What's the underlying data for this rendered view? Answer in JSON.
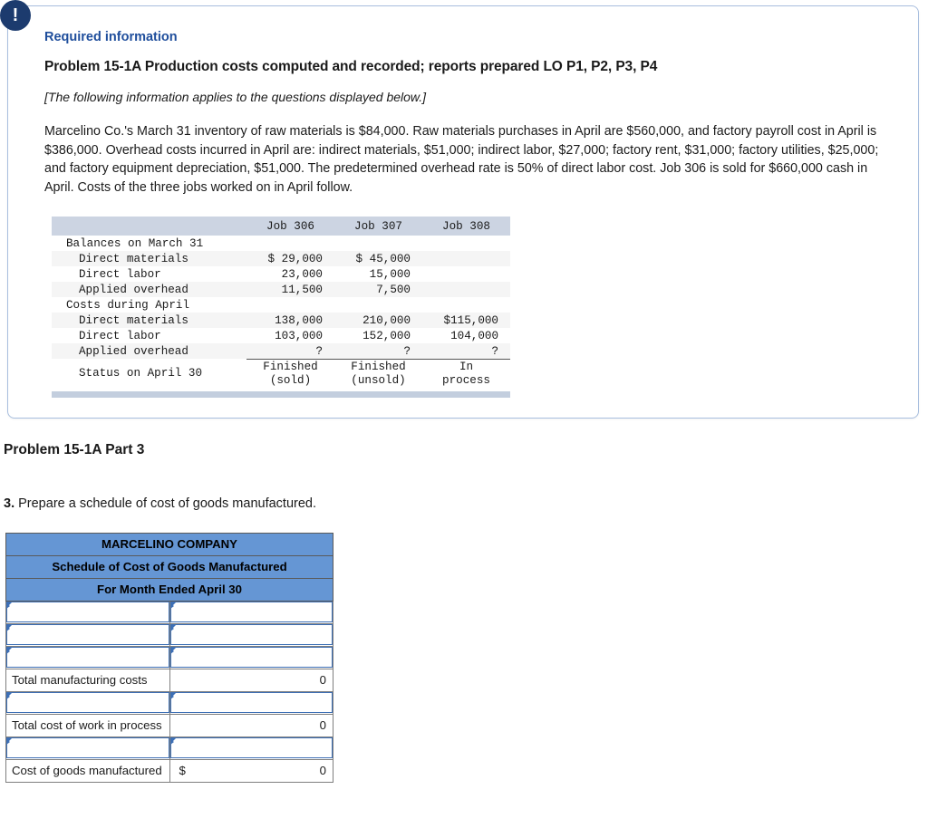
{
  "alert": {
    "icon": "exclamation-icon",
    "glyph": "!"
  },
  "card": {
    "required_label": "Required information",
    "problem_title": "Problem 15-1A Production costs computed and recorded; reports prepared LO P1, P2, P3, P4",
    "applies_note": "[The following information applies to the questions displayed below.]",
    "body": "Marcelino Co.'s March 31 inventory of raw materials is $84,000. Raw materials purchases in April are $560,000, and factory payroll cost in April is $386,000. Overhead costs incurred in April are: indirect materials, $51,000; indirect labor, $27,000; factory rent, $31,000; factory utilities, $25,000; and factory equipment depreciation, $51,000. The predetermined overhead rate is 50% of direct labor cost. Job 306 is sold for $660,000 cash in April. Costs of the three jobs worked on in April follow."
  },
  "jobs_table": {
    "columns": [
      "",
      "Job 306",
      "Job 307",
      "Job 308"
    ],
    "rows": [
      {
        "label": "Balances on March 31",
        "indent": false,
        "values": [
          "",
          "",
          ""
        ]
      },
      {
        "label": "Direct materials",
        "indent": true,
        "values": [
          "$ 29,000",
          "$ 45,000",
          ""
        ]
      },
      {
        "label": "Direct labor",
        "indent": true,
        "values": [
          "23,000",
          "15,000",
          ""
        ]
      },
      {
        "label": "Applied overhead",
        "indent": true,
        "values": [
          "11,500",
          "7,500",
          ""
        ]
      },
      {
        "label": "Costs during April",
        "indent": false,
        "values": [
          "",
          "",
          ""
        ]
      },
      {
        "label": "Direct materials",
        "indent": true,
        "values": [
          "138,000",
          "210,000",
          "$115,000"
        ]
      },
      {
        "label": "Direct labor",
        "indent": true,
        "values": [
          "103,000",
          "152,000",
          "104,000"
        ]
      },
      {
        "label": "Applied overhead",
        "indent": true,
        "values": [
          "?",
          "?",
          "?"
        ]
      }
    ],
    "status_row": {
      "label": "Status on April 30",
      "values": [
        "Finished\n(sold)",
        "Finished\n(unsold)",
        "In\nprocess"
      ]
    }
  },
  "part3": {
    "title": "Problem 15-1A Part 3",
    "question_number": "3.",
    "question_text": " Prepare a schedule of cost of goods manufactured."
  },
  "schedule": {
    "header_lines": [
      "MARCELINO COMPANY",
      "Schedule of Cost of Goods Manufactured",
      "For Month Ended April 30"
    ],
    "rows": [
      {
        "type": "input",
        "label": "",
        "value": ""
      },
      {
        "type": "input",
        "label": "",
        "value": ""
      },
      {
        "type": "input",
        "label": "",
        "value": ""
      },
      {
        "type": "total",
        "label": "Total manufacturing costs",
        "value": "0",
        "currency": ""
      },
      {
        "type": "input",
        "label": "",
        "value": ""
      },
      {
        "type": "total",
        "label": "Total cost of work in process",
        "value": "0",
        "currency": ""
      },
      {
        "type": "input",
        "label": "",
        "value": ""
      },
      {
        "type": "total",
        "label": "Cost of goods manufactured",
        "value": "0",
        "currency": "$"
      }
    ]
  },
  "colors": {
    "accent_blue": "#1f4e9c",
    "badge_navy": "#1c3b6e",
    "table_header_gray": "#ccd4e2",
    "sched_header_blue": "#6596d4",
    "input_border_blue": "#3d6fb5"
  }
}
